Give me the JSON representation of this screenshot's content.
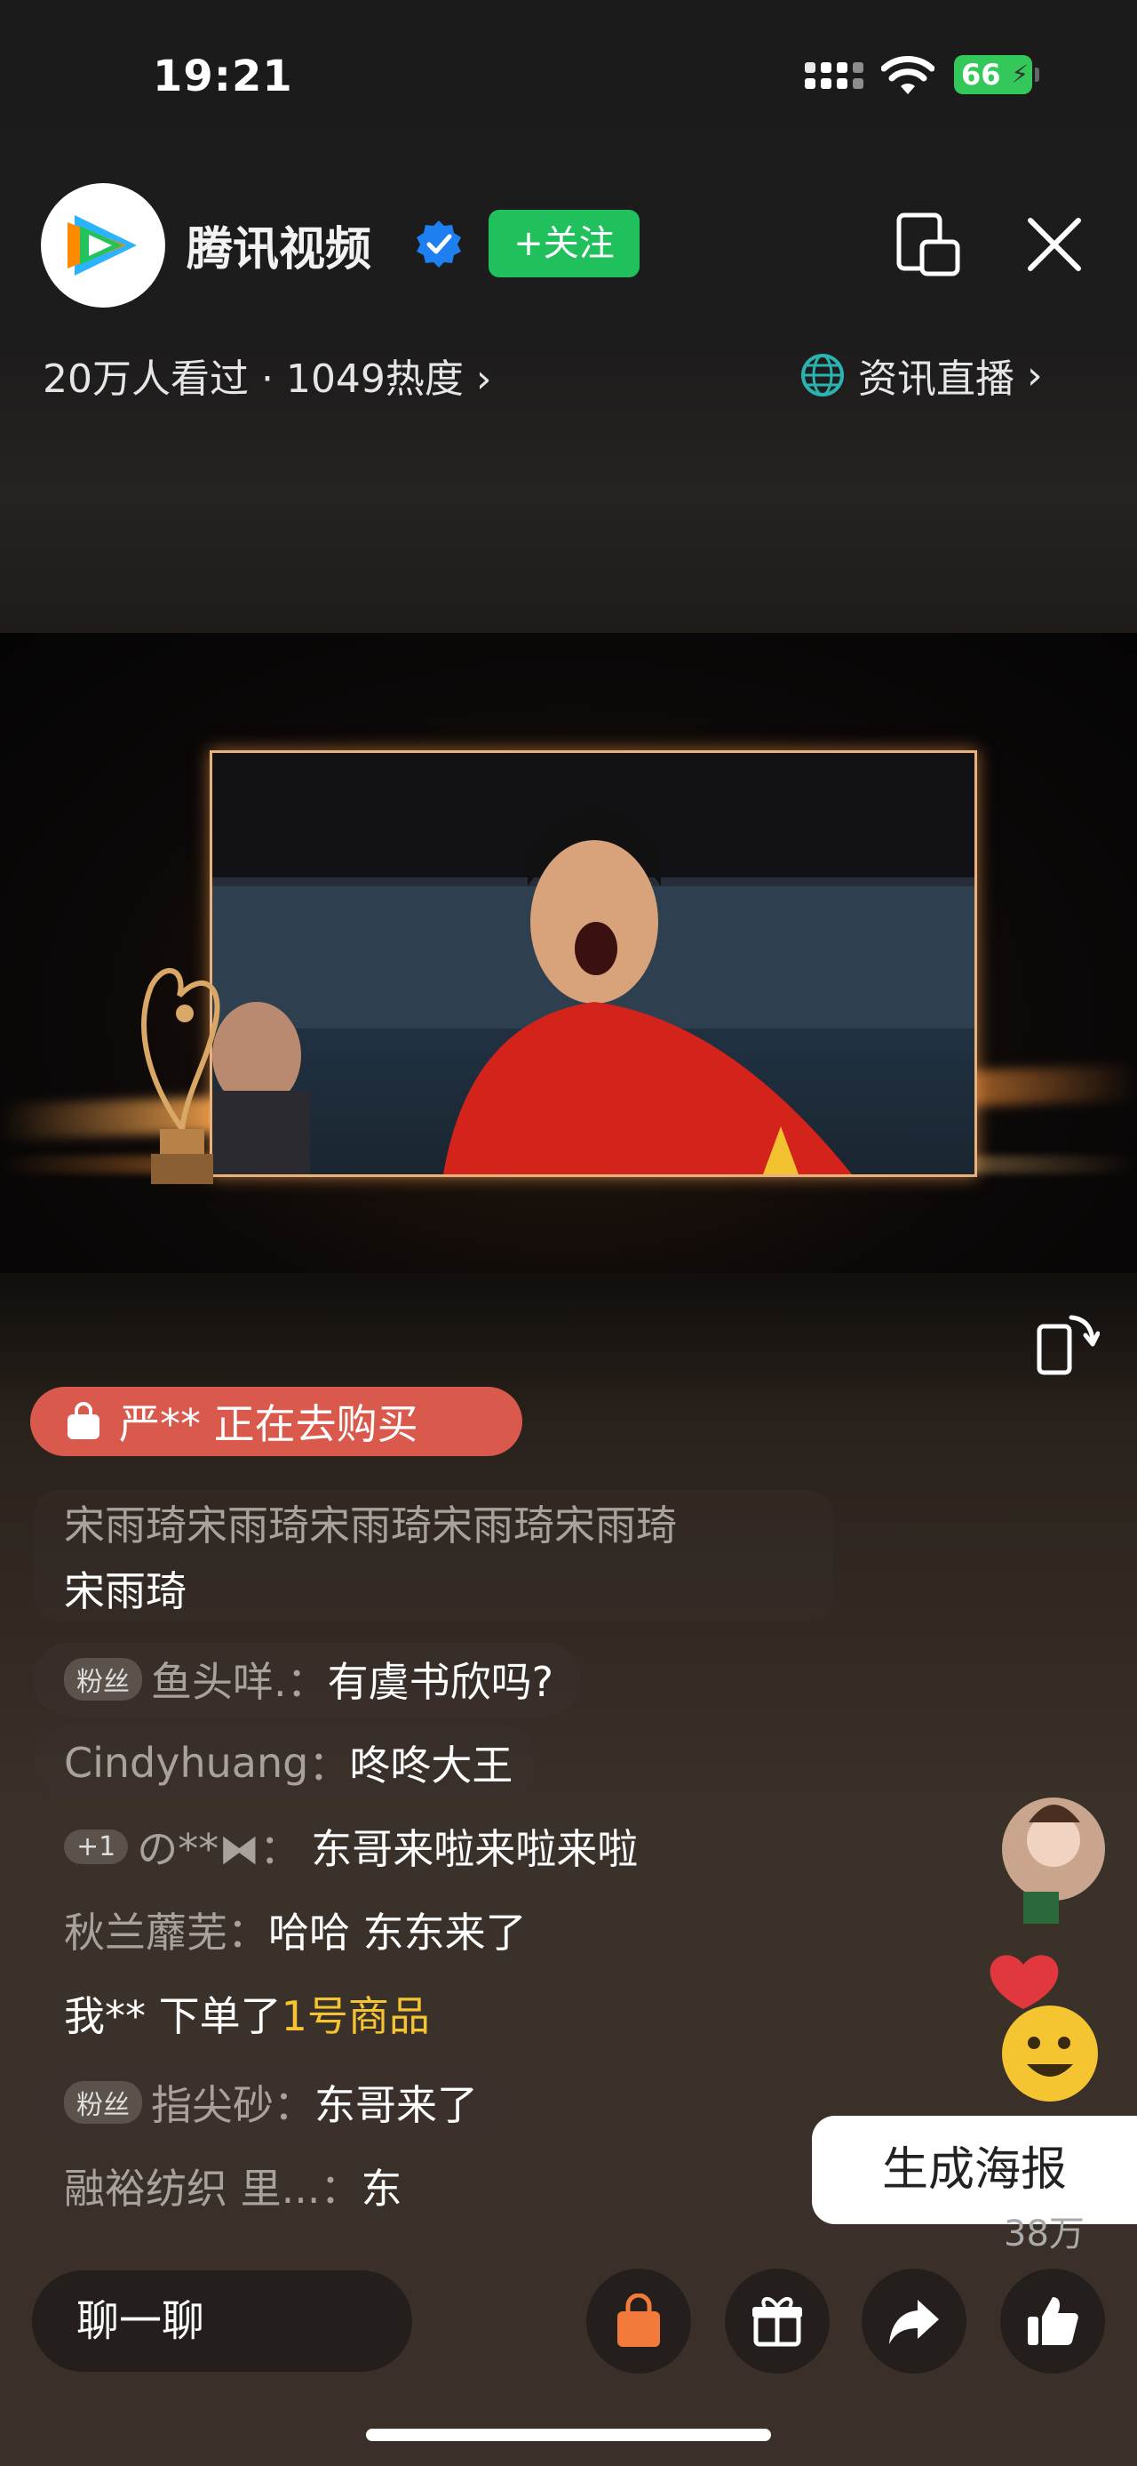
{
  "status_bar": {
    "time": "19:21",
    "battery": "66"
  },
  "header": {
    "channel_name": "腾讯视频",
    "follow_label": "+关注",
    "viewers_label": "20万人看过 · 1049热度",
    "live_type_label": "资讯直播"
  },
  "comments": {
    "buy_notice": "严** 正在去购买",
    "items": [
      {
        "line1": "宋雨琦宋雨琦宋雨琦宋雨琦宋雨琦",
        "line2": "宋雨琦"
      },
      {
        "badge": "粉丝",
        "user": "鱼头咩.",
        "text": "有虞书欣吗?"
      },
      {
        "user": "Cindyhuang",
        "text": "咚咚大王"
      },
      {
        "badge": "+1",
        "user": "の**⧓",
        "text": "东哥来啦来啦来啦"
      },
      {
        "user": "秋兰蘼芜",
        "text": "哈哈 东东来了"
      },
      {
        "prefix": "我** 下单了",
        "highlight": "1号商品"
      },
      {
        "badge": "粉丝",
        "user": "指尖砂",
        "text": "东哥来了"
      },
      {
        "user": "融裕纺织 里...",
        "text": "东"
      }
    ]
  },
  "side": {
    "poster_label": "生成海报",
    "like_count": "38万"
  },
  "bottom_bar": {
    "chat_placeholder": "聊一聊"
  },
  "icons": [
    "tencent-video-logo",
    "verified-icon",
    "pip-icon",
    "close-icon",
    "globe-icon",
    "rotate-screen-icon",
    "shopping-bag-icon",
    "gift-icon",
    "share-icon",
    "like-icon"
  ],
  "colors": {
    "follow": "#20c05c",
    "buy_pill": "#d95a4d",
    "highlight": "#f4c531",
    "shop": "#f27a3a"
  }
}
